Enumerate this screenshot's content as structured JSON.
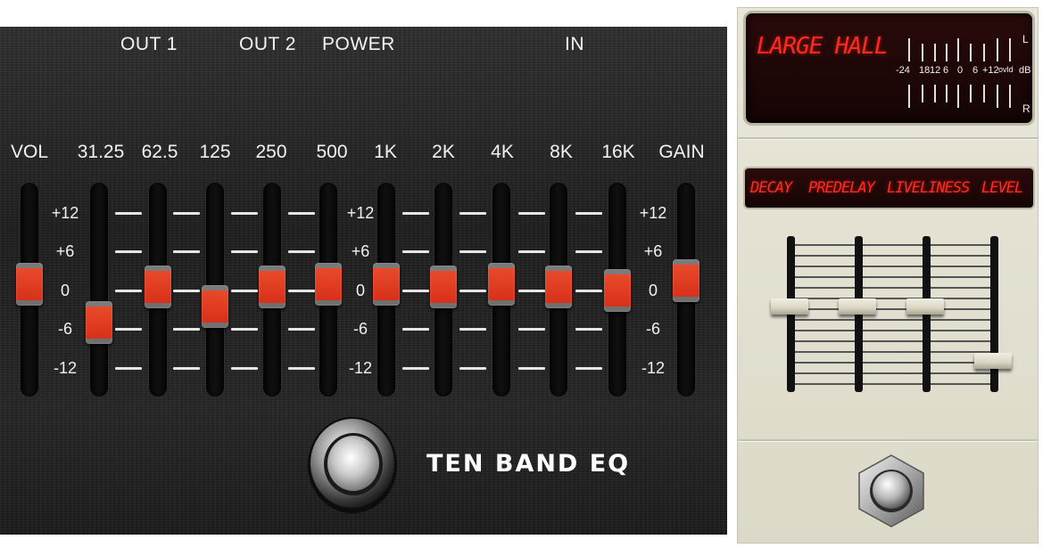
{
  "eq_pedal": {
    "jacks": [
      "OUT 1",
      "OUT 2",
      "POWER",
      "IN"
    ],
    "brand": "TEN BAND EQ",
    "scale": [
      "+12",
      "+6",
      "0",
      "-6",
      "-12"
    ],
    "sliders": [
      {
        "label": "VOL",
        "value_db": 1
      },
      {
        "label": "31.25",
        "value_db": -5
      },
      {
        "label": "62.5",
        "value_db": 0.5
      },
      {
        "label": "125",
        "value_db": -2.5
      },
      {
        "label": "250",
        "value_db": 0.5
      },
      {
        "label": "500",
        "value_db": 1
      },
      {
        "label": "1K",
        "value_db": 1
      },
      {
        "label": "2K",
        "value_db": 0.5
      },
      {
        "label": "4K",
        "value_db": 1
      },
      {
        "label": "8K",
        "value_db": 0.5
      },
      {
        "label": "16K",
        "value_db": 0
      },
      {
        "label": "GAIN",
        "value_db": 1.5
      }
    ],
    "colors": {
      "panel": "#222222",
      "knob": "#e03a22",
      "text": "#f2f2f2"
    }
  },
  "reverb_pedal": {
    "preset_name": "LARGE HALL",
    "meter_scale": [
      "-24",
      "18",
      "12",
      "6",
      "0",
      "6",
      "+12",
      "ovld",
      "dB"
    ],
    "meter_channels": [
      "L",
      "R"
    ],
    "params": [
      {
        "label": "DECAY",
        "level": 0.55
      },
      {
        "label": "PREDELAY",
        "level": 0.55
      },
      {
        "label": "LIVELINESS",
        "level": 0.55
      },
      {
        "label": "LEVEL",
        "level": 0.2
      }
    ],
    "colors": {
      "body": "#e2e0d0",
      "display": "#1d0707",
      "display_text": "#ff2a1f"
    }
  }
}
